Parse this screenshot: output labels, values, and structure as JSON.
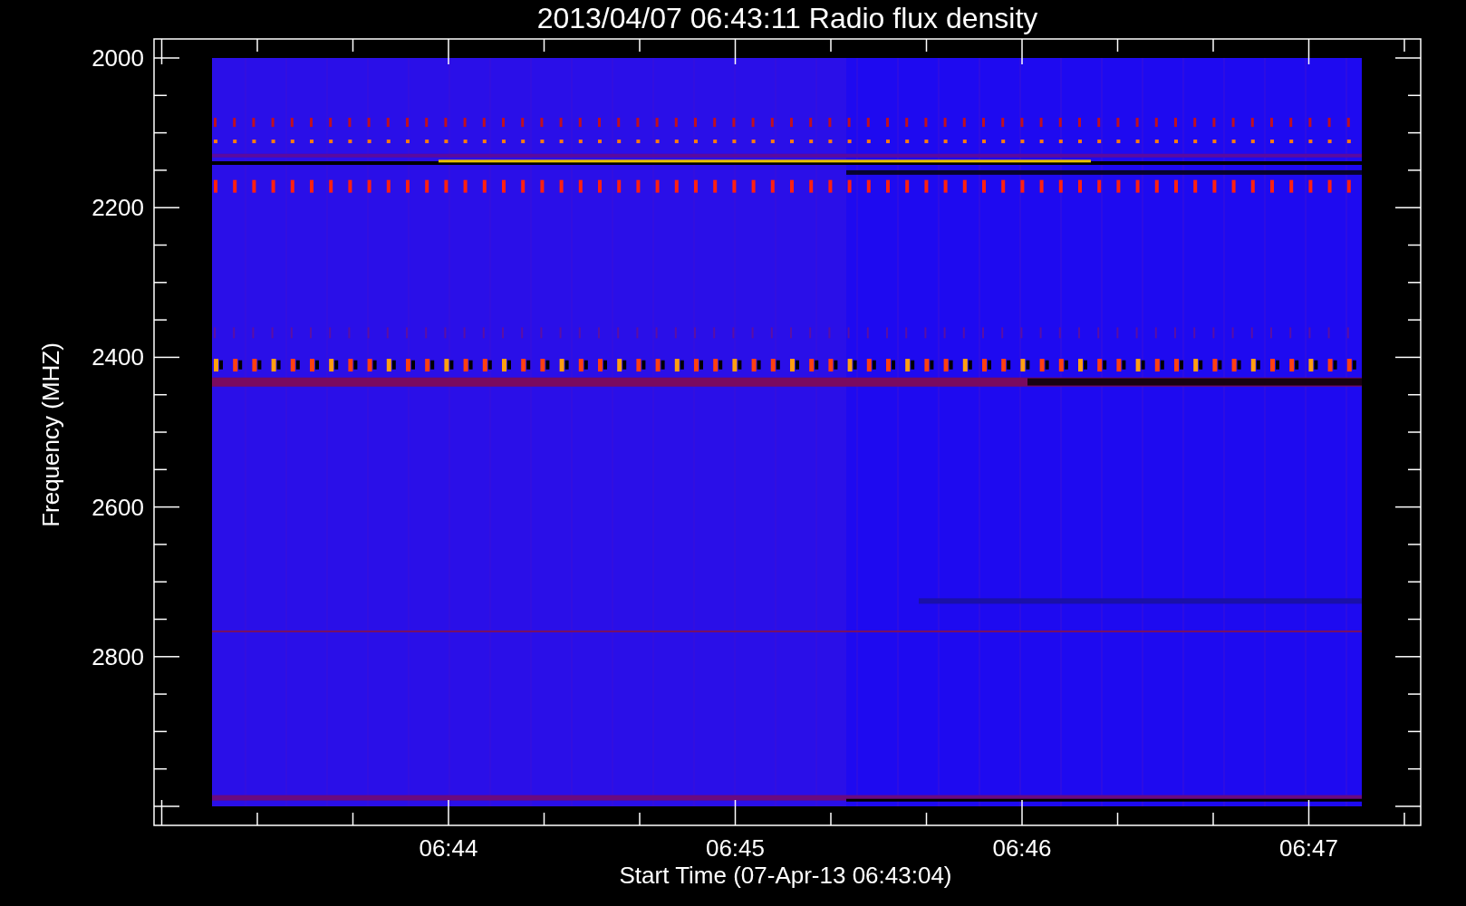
{
  "plot": {
    "title": "2013/04/07 06:43:11 Radio flux density",
    "ylabel": "Frequency (MHZ)",
    "yticks": [
      "2000",
      "2200",
      "2400",
      "2600",
      "2800"
    ],
    "xticks": [
      "06:44",
      "06:45",
      "06:46",
      "06:47"
    ],
    "xlabel": "Start Time (07-Apr-13 06:43:04)"
  }
}
